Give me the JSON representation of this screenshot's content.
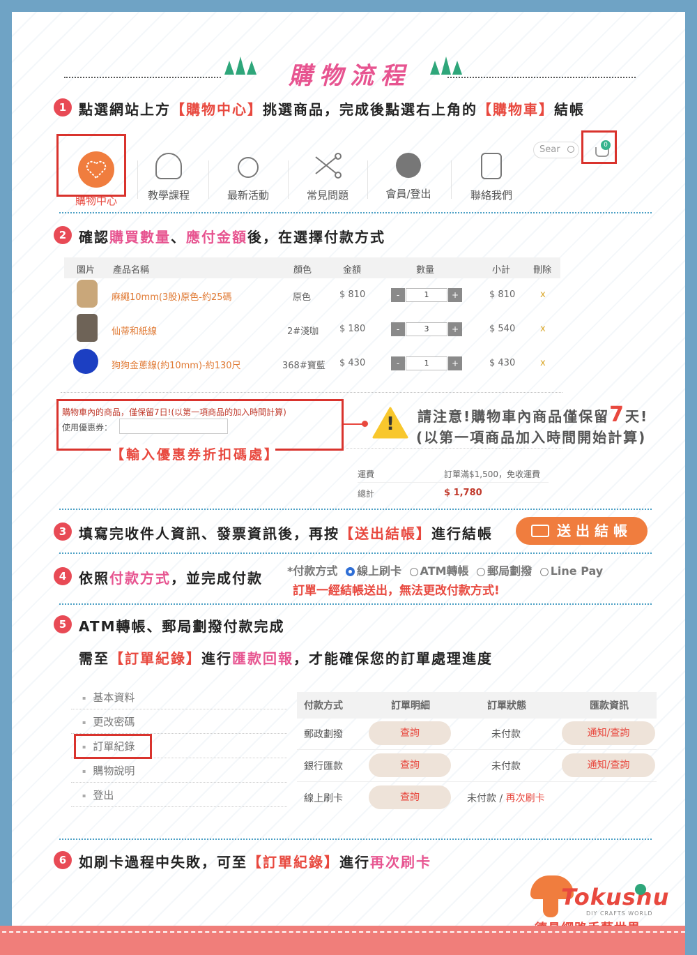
{
  "colors": {
    "accent_red": "#e8483e",
    "accent_pink": "#e75490",
    "orange": "#f07d3e",
    "blue_frame": "#6fa3c5",
    "footer": "#f07e7a"
  },
  "header": {
    "title": "購物流程"
  },
  "step1": {
    "num": "1",
    "t1": "點選網站上方",
    "t2": "【購物中心】",
    "t3": "挑選商品，完成後點選右上角的",
    "t4": "【購物車】",
    "t5": "結帳"
  },
  "nav": {
    "items": [
      {
        "label": "購物中心",
        "icon": "heart-ball-icon"
      },
      {
        "label": "教學課程",
        "icon": "spool-icon"
      },
      {
        "label": "最新活動",
        "icon": "button-icon"
      },
      {
        "label": "常見問題",
        "icon": "scissors-icon"
      },
      {
        "label": "會員/登出",
        "icon": "yarn-ball-icon"
      },
      {
        "label": "聯絡我們",
        "icon": "jar-icon"
      }
    ],
    "search_placeholder": "Sear",
    "cart_count": "0"
  },
  "step2": {
    "num": "2",
    "t1": "確認",
    "t2": "購買數量",
    "t3": "、",
    "t4": "應付金額",
    "t5": "後，在選擇付款方式"
  },
  "cart": {
    "headers": [
      "圖片",
      "產品名稱",
      "顏色",
      "金額",
      "數量",
      "小計",
      "刪除"
    ],
    "rows": [
      {
        "name": "麻繩10mm(3股)原色-約25碼",
        "color": "原色",
        "price": "$ 810",
        "qty": "1",
        "subtotal": "$ 810",
        "del": "x",
        "minus": "-",
        "plus": "+"
      },
      {
        "name": "仙蒂和紙線",
        "color": "2#淺咖",
        "price": "$ 180",
        "qty": "3",
        "subtotal": "$ 540",
        "del": "x",
        "minus": "-",
        "plus": "+"
      },
      {
        "name": "狗狗金蔥線(約10mm)-約130尺",
        "color": "368#寶藍",
        "price": "$ 430",
        "qty": "1",
        "subtotal": "$ 430",
        "del": "x",
        "minus": "-",
        "plus": "+"
      }
    ],
    "notice": "購物車內的商品，僅保留7日!(以第一項商品的加入時間計算)",
    "coupon_label": "使用優惠券：",
    "coupon_caption": "【輸入優惠券折扣碼處】",
    "shipping_label": "運費",
    "shipping_value": "訂單滿$1,500，免收運費",
    "total_label": "總計",
    "total_value": "$ 1,780"
  },
  "warning": {
    "l1a": "請注意!購物車內商品僅保留",
    "days": "7",
    "l1b": "天!",
    "l2": "(以第一項商品加入時間開始計算)",
    "icon": "warning-icon",
    "mark": "!"
  },
  "step3": {
    "num": "3",
    "t1": "填寫完收件人資訊、發票資訊後，再按",
    "t2": "【送出結帳】",
    "t3": "進行結帳",
    "button": "送出結帳"
  },
  "step4": {
    "num": "4",
    "t1": "依照",
    "t2": "付款方式",
    "t3": "，並完成付款",
    "pay_label": "*付款方式",
    "opt1": "線上刷卡",
    "opt2": "ATM轉帳",
    "opt3": "郵局劃撥",
    "opt4": "Line Pay",
    "note": "訂單一經結帳送出，無法更改付款方式!"
  },
  "step5": {
    "num": "5",
    "t1": "ATM轉帳、郵局劃撥付款完成",
    "s1": "需至",
    "s2": "【訂單紀錄】",
    "s3": "進行",
    "s4": "匯款回報",
    "s5": "，才能確保您的訂單處理進度"
  },
  "menu": [
    "基本資料",
    "更改密碼",
    "訂單紀錄",
    "購物說明",
    "登出"
  ],
  "orders": {
    "headers": [
      "付款方式",
      "訂單明細",
      "訂單狀態",
      "匯款資訊"
    ],
    "rows": [
      {
        "method": "郵政劃撥",
        "detail": "查詢",
        "status": "未付款",
        "info": "通知/查詢"
      },
      {
        "method": "銀行匯款",
        "detail": "查詢",
        "status": "未付款",
        "info": "通知/查詢"
      },
      {
        "method": "線上刷卡",
        "detail": "查詢",
        "status": "未付款 / ",
        "status2": "再次刷卡"
      }
    ]
  },
  "step6": {
    "num": "6",
    "t1": "如刷卡過程中失敗，可至",
    "t2": "【訂單紀錄】",
    "t3": "進行",
    "t4": "再次刷卡"
  },
  "logo": {
    "brand": "Tokushu",
    "tagline": "DIY CRAFTS WORLD",
    "cn": "德昌網路手藝世界"
  }
}
